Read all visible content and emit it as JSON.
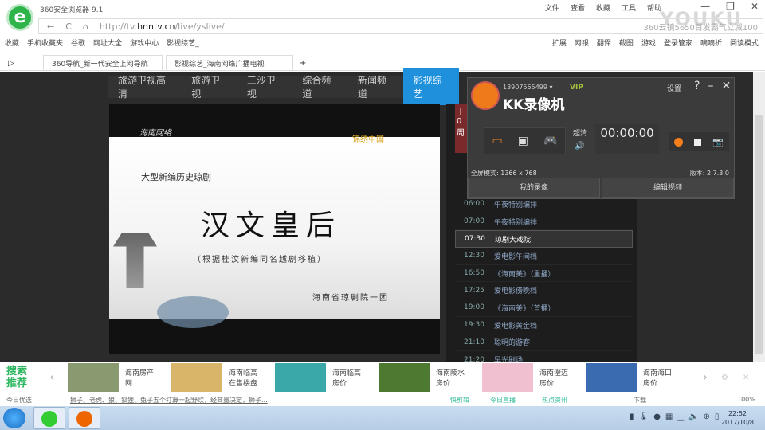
{
  "browser": {
    "title": "360安全浏览器 9.1",
    "menus": [
      "文件",
      "查看",
      "收藏",
      "工具",
      "帮助"
    ],
    "url_prefix": "http://tv.",
    "url_domain": "hnntv.cn",
    "url_path": "/live/yslive/",
    "search_placeholder": "360云镜5650首发霸气立减100",
    "bookmarks": [
      "收藏",
      "手机收藏夹",
      "谷歌",
      "网址大全",
      "游戏中心",
      "影视综艺_"
    ],
    "tools": [
      "扩展",
      "网银",
      "翻译",
      "截图",
      "游戏",
      "登录管家",
      "嘀嘀折",
      "阅读模式"
    ],
    "tabs": [
      {
        "label": "360导航_新一代安全上网导航"
      },
      {
        "label": "影视综艺_海南网络广播电视"
      }
    ],
    "watermark": "YOUKU"
  },
  "channels": [
    "旅游卫视高清",
    "旅游卫视",
    "三沙卫视",
    "综合频道",
    "新闻频道",
    "影视综艺"
  ],
  "video": {
    "logo": "海南网络",
    "logo2": "锦绣中国",
    "subtitle": "大型新编历史琼剧",
    "title": "汉文皇后",
    "note": "（根据桂汶新编同名越剧移植）",
    "troupe": "海南省琼剧院一团"
  },
  "schedule": {
    "date_card": "十 0 周",
    "items": [
      {
        "time": "06:00",
        "name": "午夜特别编排"
      },
      {
        "time": "07:00",
        "name": "午夜特别编排"
      },
      {
        "time": "07:30",
        "name": "琼剧大戏院",
        "active": true
      },
      {
        "time": "12:30",
        "name": "爱电影午间档"
      },
      {
        "time": "16:50",
        "name": "《海南美》（重播）"
      },
      {
        "time": "17:25",
        "name": "爱电影傍晚档"
      },
      {
        "time": "19:00",
        "name": "《海南美》（首播）"
      },
      {
        "time": "19:30",
        "name": "爱电影黄金档"
      },
      {
        "time": "21:10",
        "name": "聪明的游客"
      },
      {
        "time": "21:20",
        "name": "早光剧场"
      }
    ]
  },
  "kk": {
    "user": "13907565499",
    "vip": "VIP",
    "name": "KK录像机",
    "settings": "设置",
    "quality": "超清",
    "timer": "00:00:00",
    "fullscreen": "全屏模式: 1366 x 768",
    "version": "版本: 2.7.3.0",
    "my_recordings": "我的录像",
    "edit_video": "编辑视频"
  },
  "recommend": {
    "label": "搜索推荐",
    "items": [
      {
        "l1": "海南房产",
        "l2": "网",
        "color": "#8a9a70"
      },
      {
        "l1": "海南临高",
        "l2": "在售楼盘",
        "color": "#d9b56a"
      },
      {
        "l1": "海南临高",
        "l2": "房价",
        "color": "#3aa8a8"
      },
      {
        "l1": "海南陵水",
        "l2": "房价",
        "color": "#4d7a30"
      },
      {
        "l1": "海南澄迈",
        "l2": "房价",
        "color": "#f0c0d0"
      },
      {
        "l1": "海南海口",
        "l2": "房价",
        "color": "#3a6ab0"
      }
    ]
  },
  "statusbar": {
    "today": "今日优选",
    "news": "狮子、老虎、狼、狐狸、兔子五个打算一起野炊，经商量决定，狮子...",
    "items": [
      "快剪辑",
      "今日直播",
      "热点资讯",
      "下载"
    ],
    "zoom": "100%"
  },
  "taskbar": {
    "time": "22:52",
    "date": "2017/10/8"
  }
}
